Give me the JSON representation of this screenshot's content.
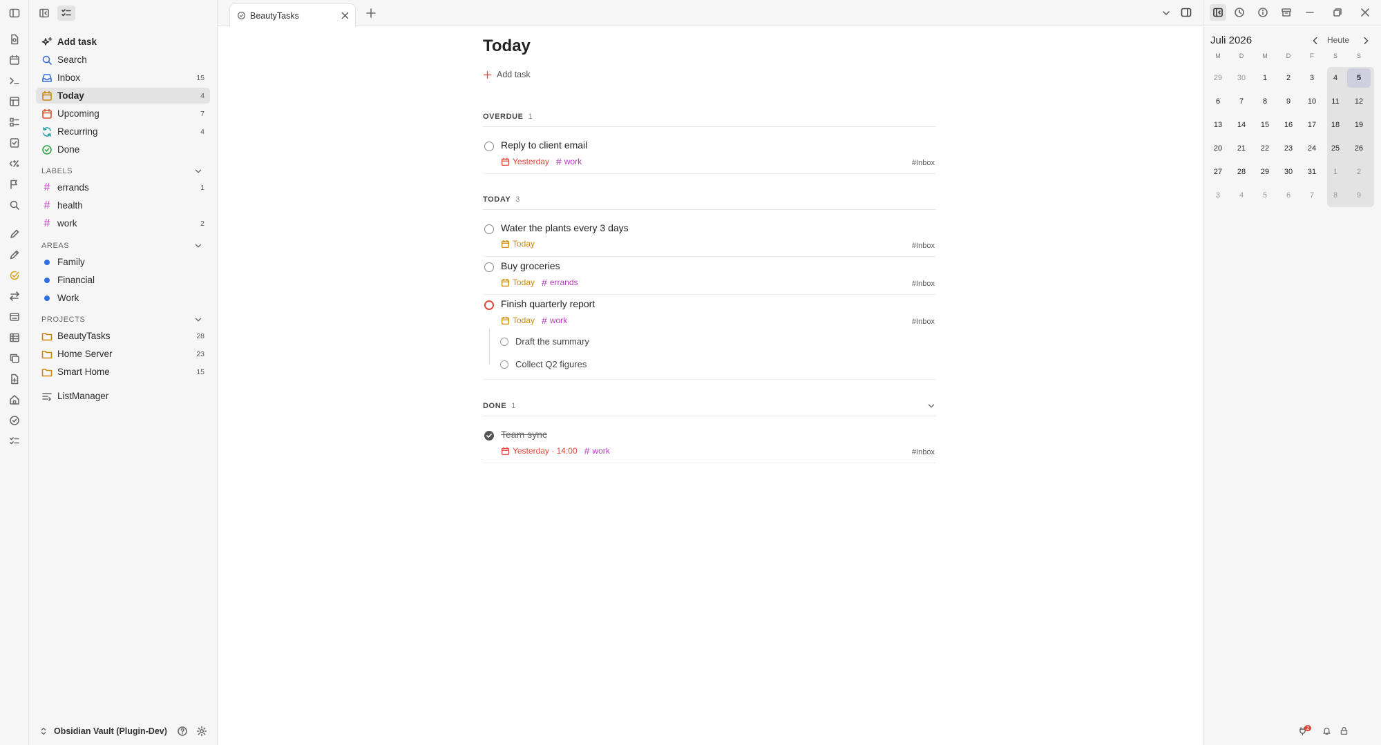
{
  "sidebar": {
    "nav": [
      {
        "label": "Add task",
        "count": ""
      },
      {
        "label": "Search",
        "count": ""
      },
      {
        "label": "Inbox",
        "count": "15"
      },
      {
        "label": "Today",
        "count": "4"
      },
      {
        "label": "Upcoming",
        "count": "7"
      },
      {
        "label": "Recurring",
        "count": "4"
      },
      {
        "label": "Done",
        "count": ""
      }
    ],
    "labels_heading": "LABELS",
    "labels": [
      {
        "label": "errands",
        "count": "1"
      },
      {
        "label": "health",
        "count": ""
      },
      {
        "label": "work",
        "count": "2"
      }
    ],
    "areas_heading": "AREAS",
    "areas": [
      {
        "label": "Family"
      },
      {
        "label": "Financial"
      },
      {
        "label": "Work"
      }
    ],
    "projects_heading": "PROJECTS",
    "projects": [
      {
        "label": "BeautyTasks",
        "count": "28"
      },
      {
        "label": "Home Server",
        "count": "23"
      },
      {
        "label": "Smart Home",
        "count": "15"
      }
    ],
    "list_manager": "ListManager",
    "vault": "Obsidian Vault (Plugin-Dev)"
  },
  "tab": {
    "title": "BeautyTasks"
  },
  "main": {
    "title": "Today",
    "add_task": "Add task",
    "overdue": {
      "heading": "OVERDUE",
      "count": "1"
    },
    "today": {
      "heading": "TODAY",
      "count": "3"
    },
    "done": {
      "heading": "DONE",
      "count": "1"
    },
    "tasks": [
      {
        "title": "Reply to client email",
        "date": "Yesterday",
        "label": "work",
        "project": "#Inbox"
      },
      {
        "title": "Water the plants every 3 days",
        "date": "Today",
        "label": "",
        "project": "#Inbox"
      },
      {
        "title": "Buy groceries",
        "date": "Today",
        "label": "errands",
        "project": "#Inbox"
      },
      {
        "title": "Finish quarterly report",
        "date": "Today",
        "label": "work",
        "project": "#Inbox"
      },
      {
        "title": "Team sync",
        "date": "Yesterday · 14:00",
        "label": "work",
        "project": "#Inbox"
      }
    ],
    "subtasks": [
      "Draft the summary",
      "Collect Q2 figures"
    ]
  },
  "calendar": {
    "month": "Juli 2026",
    "today_btn": "Heute",
    "weekdays": [
      "M",
      "D",
      "M",
      "D",
      "F",
      "S",
      "S"
    ],
    "weeks": [
      [
        "29",
        "30",
        "1",
        "2",
        "3",
        "4",
        "5"
      ],
      [
        "6",
        "7",
        "8",
        "9",
        "10",
        "11",
        "12"
      ],
      [
        "13",
        "14",
        "15",
        "16",
        "17",
        "18",
        "19"
      ],
      [
        "20",
        "21",
        "22",
        "23",
        "24",
        "25",
        "26"
      ],
      [
        "27",
        "28",
        "29",
        "30",
        "31",
        "1",
        "2"
      ],
      [
        "3",
        "4",
        "5",
        "6",
        "7",
        "8",
        "9"
      ]
    ]
  },
  "colors": {
    "overdue_red": "#e0463b",
    "today_orange": "#c98a0c",
    "label_purple": "#b43cbd",
    "area_blue": "#2f6fe0",
    "done_green": "#2ea043"
  },
  "status": {
    "badge": "2"
  }
}
